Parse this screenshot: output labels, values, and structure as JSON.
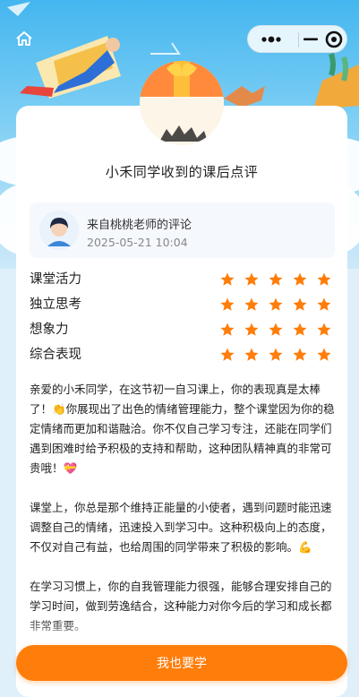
{
  "nav": {
    "capsule": {
      "more_icon": "more-dots-icon",
      "minimize_icon": "minimize-icon",
      "close_icon": "record-close-icon"
    }
  },
  "report": {
    "title": "小禾同学收到的课后点评",
    "teacher": {
      "label": "来自桃桃老师的评论",
      "datetime": "2025-05-21 10:04"
    }
  },
  "ratings": [
    {
      "label": "课堂活力",
      "stars": 5
    },
    {
      "label": "独立思考",
      "stars": 5
    },
    {
      "label": "想象力",
      "stars": 5
    },
    {
      "label": "综合表现",
      "stars": 5
    }
  ],
  "comment": {
    "paragraphs": [
      "亲爱的小禾同学，在这节初一自习课上，你的表现真是太棒了！👏你展现出了出色的情绪管理能力，整个课堂因为你的稳定情绪而更加和谐融洽。你不仅自己学习专注，还能在同学们遇到困难时给予积极的支持和帮助，这种团队精神真的非常可贵哦！💝",
      "课堂上，你总是那个维持正能量的小使者，遇到问题时能迅速调整自己的情绪，迅速投入到学习中。这种积极向上的态度，不仅对自己有益，也给周围的同学带来了积极的影响。💪",
      "在学习习惯上，你的自我管理能力很强，能够合理安排自己的学习时间，做到劳逸结合，这种能力对你今后的学习和成长都非常重要。"
    ]
  },
  "cta": {
    "label": "我也要学"
  },
  "colors": {
    "accent": "#ff7d0a",
    "star": "#ff7d0a",
    "sky": "#44b6ef"
  }
}
